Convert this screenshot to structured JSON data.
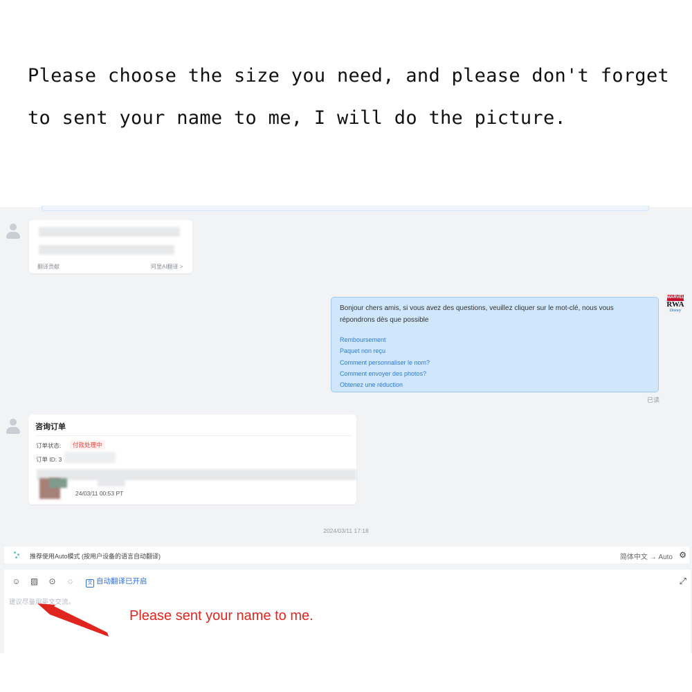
{
  "headline": {
    "line1": "Please choose the size you need, and please don't forget",
    "line2": "to sent your name to me, I will do the picture."
  },
  "chat": {
    "first_message": {
      "footer_left": "翻译贡献",
      "footer_right": "阿里AI翻译 >"
    },
    "merchant_message": {
      "greeting": "Bonjour chers amis, si vous avez des questions, veuillez cliquer sur le mot-clé, nous vous répondrons dès que possible",
      "quick_links": [
        "Remboursement",
        "Paquet non reçu",
        "Comment personnaliser le nom?",
        "Comment envoyer des photos?",
        "Obtenez une réduction"
      ],
      "read_status": "已读",
      "brand_logo": {
        "top": "MARVEL",
        "middle": "RWA",
        "bottom": "Disney"
      }
    },
    "order_card": {
      "title": "咨询订单",
      "status_label": "订单状态:",
      "status_value": "付款处理中",
      "order_id_label": "订单 ID: 3",
      "order_time": "24/03/11 00:53 PT"
    },
    "timestamp": "2024/03/11 17:18",
    "auto_mode_bar": {
      "tip": "推荐使用Auto模式 (按用户设备的语言自动翻译)",
      "language": "简体中文 → Auto",
      "settings_icon": "gear-icon"
    },
    "composer": {
      "tools": [
        "emoji-icon",
        "image-icon",
        "video-icon",
        "chat-icon"
      ],
      "auto_translate": "自动翻译已开启",
      "placeholder": "建议尽量用英文交流。",
      "expand_icon": "expand-icon"
    }
  },
  "annotation": {
    "text": "Please sent your name to me.",
    "color": "#e0251f"
  },
  "colors": {
    "bubble_bg": "#cfe6fb",
    "link": "#2e7bd6",
    "status_red": "#e8413a",
    "chat_bg": "#f2f3f5"
  }
}
